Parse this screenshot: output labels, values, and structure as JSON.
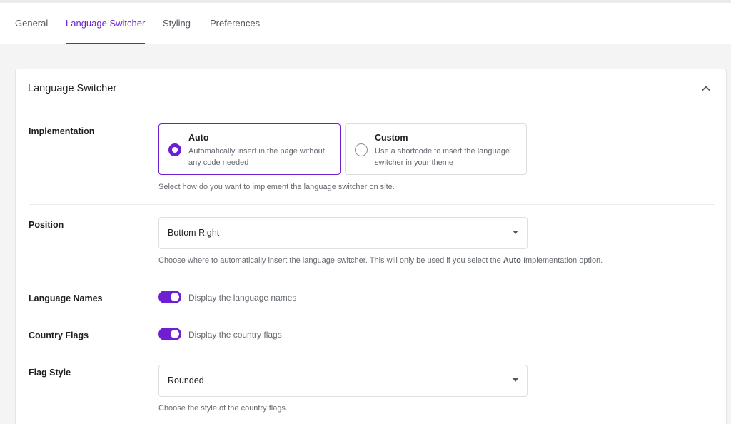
{
  "tabs": [
    {
      "label": "General",
      "active": false
    },
    {
      "label": "Language Switcher",
      "active": true
    },
    {
      "label": "Styling",
      "active": false
    },
    {
      "label": "Preferences",
      "active": false
    }
  ],
  "panel": {
    "title": "Language Switcher",
    "collapse_icon": "chevron-up-icon"
  },
  "implementation": {
    "label": "Implementation",
    "options": [
      {
        "title": "Auto",
        "description": "Automatically insert in the page without any code needed",
        "selected": true
      },
      {
        "title": "Custom",
        "description": "Use a shortcode to insert the language switcher in your theme",
        "selected": false
      }
    ],
    "help": "Select how do you want to implement the language switcher on site."
  },
  "position": {
    "label": "Position",
    "value": "Bottom Right",
    "help_before": "Choose where to automatically insert the language switcher. This will only be used if you select the ",
    "help_bold": "Auto",
    "help_after": " Implementation option."
  },
  "language_names": {
    "label": "Language Names",
    "enabled": true,
    "text": "Display the language names"
  },
  "country_flags": {
    "label": "Country Flags",
    "enabled": true,
    "text": "Display the country flags"
  },
  "flag_style": {
    "label": "Flag Style",
    "value": "Rounded",
    "help": "Choose the style of the country flags."
  },
  "colors": {
    "accent": "#6e1fd1",
    "text": "#1e1e1e",
    "muted": "#646970",
    "background": "#f4f4f5"
  }
}
